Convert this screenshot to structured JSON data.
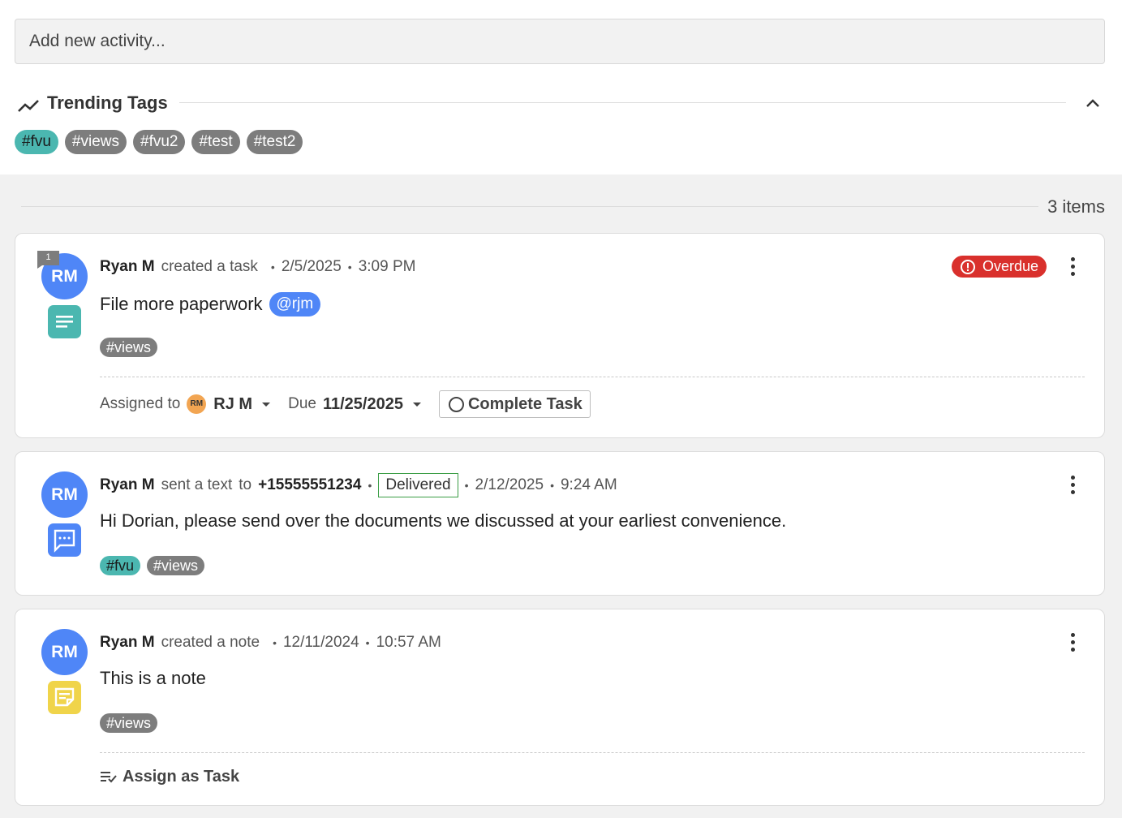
{
  "top": {
    "add_activity_placeholder": "Add new activity...",
    "trending_title": "Trending Tags",
    "tags": [
      "#fvu",
      "#views",
      "#fvu2",
      "#test",
      "#test2"
    ]
  },
  "feed": {
    "item_count": "3 items",
    "items": [
      {
        "initials": "RM",
        "comment_count": "1",
        "author": "Ryan M",
        "verb": "created a task",
        "date": "2/5/2025",
        "time": "3:09 PM",
        "status": "Overdue",
        "text": "File more paperwork",
        "mention": "@rjm",
        "tags": [
          "#views"
        ],
        "assigned_label": "Assigned to",
        "assignee_initials": "RM",
        "assignee": "RJ M",
        "due_label": "Due",
        "due_date": "11/25/2025",
        "complete_label": "Complete Task"
      },
      {
        "initials": "RM",
        "author": "Ryan M",
        "verb": "sent a text",
        "to_label": "to",
        "phone": "+15555551234",
        "delivery_status": "Delivered",
        "date": "2/12/2025",
        "time": "9:24 AM",
        "text": "Hi Dorian, please send over the documents we discussed at your earliest convenience.",
        "tags": [
          "#fvu",
          "#views"
        ]
      },
      {
        "initials": "RM",
        "author": "Ryan M",
        "verb": "created a note",
        "date": "12/11/2024",
        "time": "10:57 AM",
        "text": "This is a note",
        "tags": [
          "#views"
        ],
        "assign_label": "Assign as Task"
      }
    ]
  },
  "colors": {
    "avatar": "#4f86f7",
    "tag_gray": "#7d7d7d",
    "tag_teal": "#4bb7b0",
    "overdue": "#d9302c",
    "delivered_border": "#3a9d45",
    "task_icon": "#4bb7b0",
    "text_icon": "#4f86f7",
    "note_icon": "#f0d44a"
  },
  "icons": [
    "trending-up-icon",
    "chevron-up-icon",
    "comment-icon",
    "task-icon",
    "chat-icon",
    "note-icon",
    "alert-circle-icon",
    "more-vert-icon",
    "circle-icon",
    "playlist-check-icon"
  ]
}
